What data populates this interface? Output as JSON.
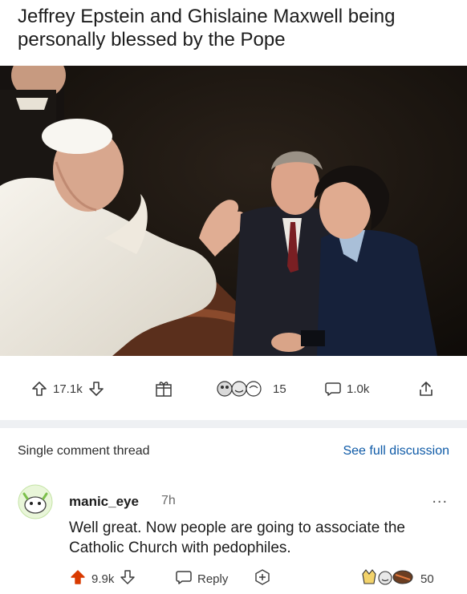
{
  "post": {
    "title": "Jeffrey Epstein and Ghislaine Maxwell being personally blessed by the Pope"
  },
  "actions": {
    "upvotes": "17.1k",
    "awards_count": "15",
    "comments": "1.0k"
  },
  "thread": {
    "label": "Single comment thread",
    "full_discussion_link": "See full discussion"
  },
  "comment": {
    "username": "manic_eye",
    "time": "7h",
    "more": "...",
    "body": "Well great. Now people are going to associate the Catholic Church with pedophiles.",
    "score": "9.9k",
    "reply_label": "Reply",
    "awards_count": "50"
  },
  "colors": {
    "upvote_active": "#d93a00",
    "link_blue": "#0e5aa7",
    "text": "#1c1c1c"
  },
  "icons": [
    "upvote-icon",
    "downvote-icon",
    "gift-icon",
    "award-icon",
    "comment-icon",
    "share-icon",
    "reply-icon",
    "add-icon",
    "more-icon"
  ]
}
